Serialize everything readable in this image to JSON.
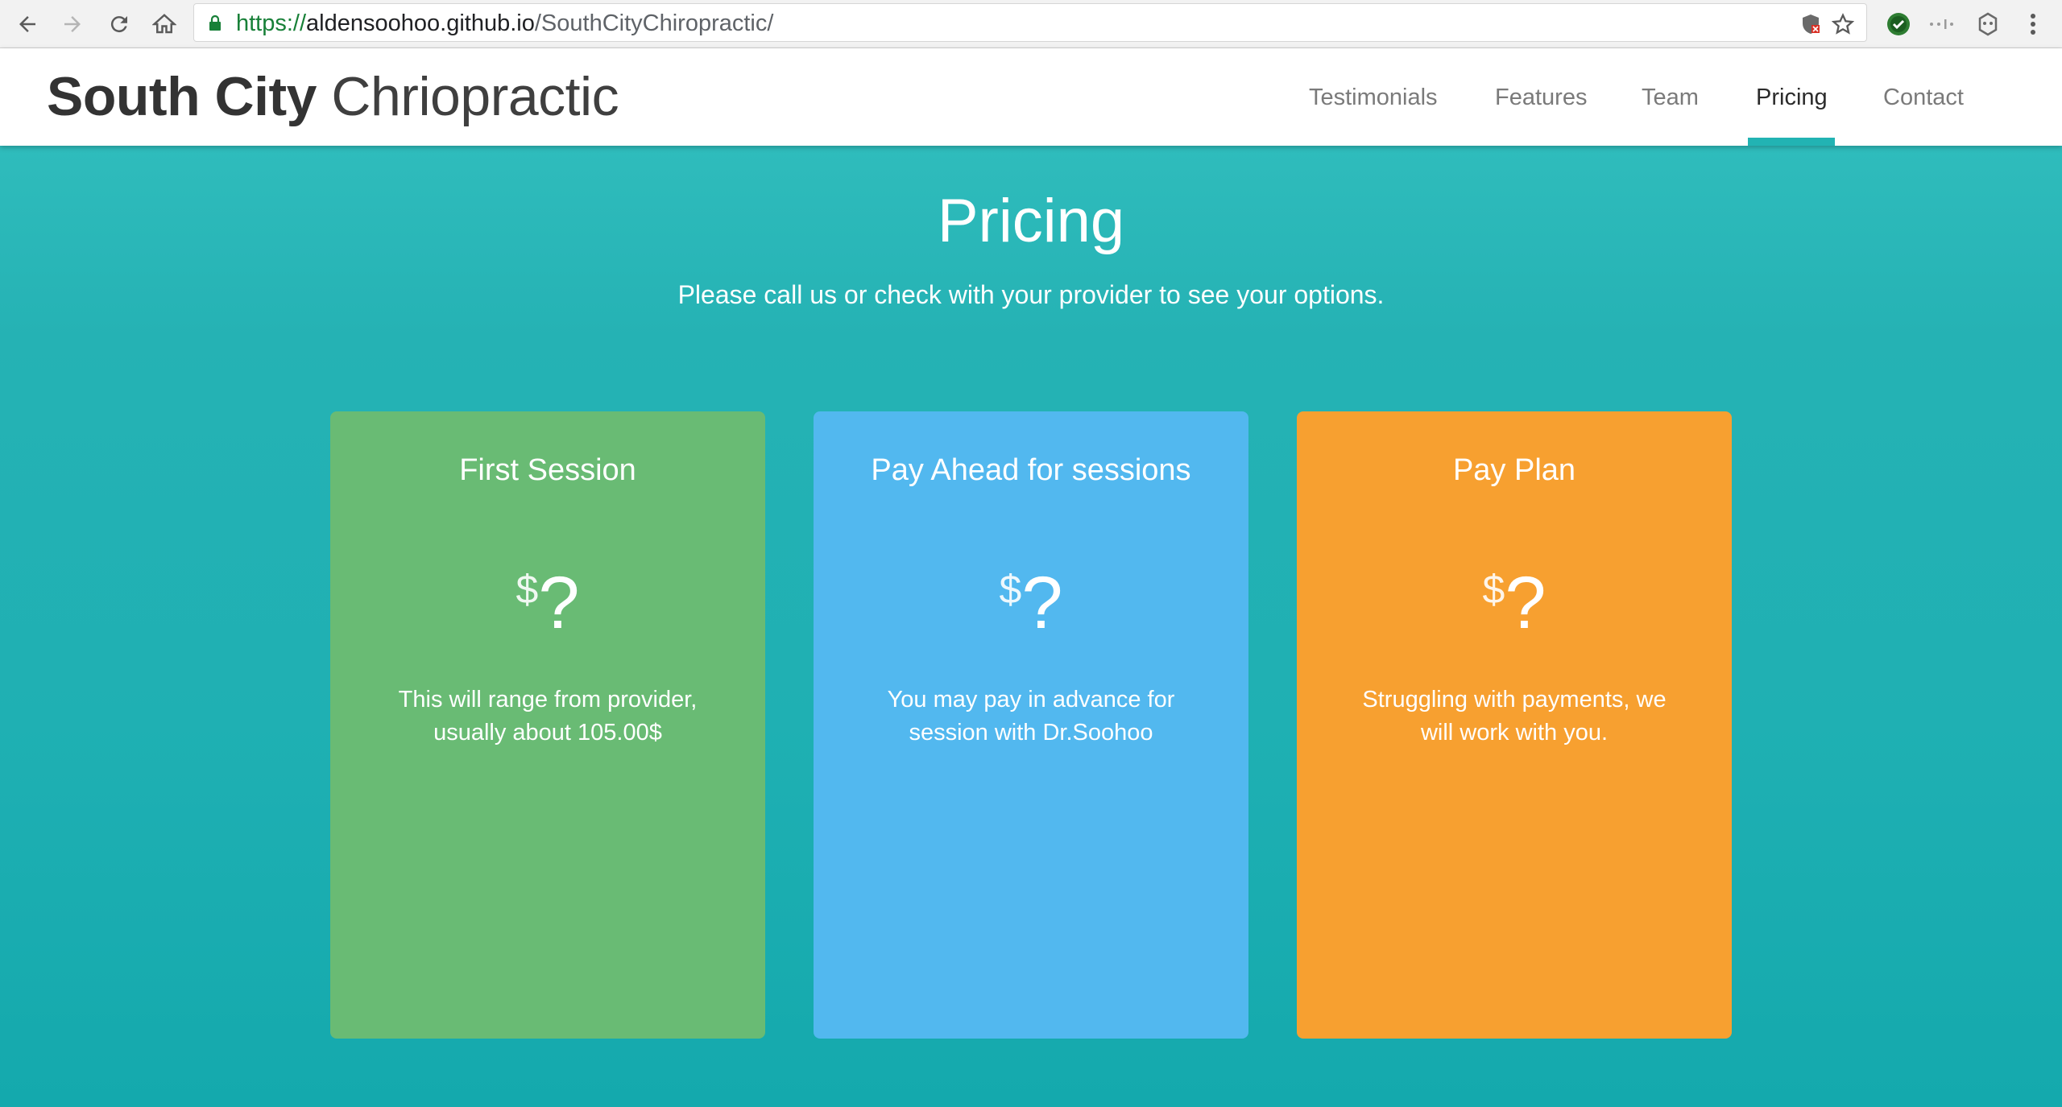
{
  "browser": {
    "url_scheme": "https://",
    "url_host": "aldensoohoo.github.io",
    "url_path": "/SouthCityChiropractic/",
    "icons": {
      "back": "back-arrow-icon",
      "forward": "forward-arrow-icon",
      "reload": "reload-icon",
      "home": "home-icon",
      "lock": "lock-icon",
      "shield": "shield-icon",
      "star": "star-icon",
      "extension_green": "extension-check-icon",
      "extension_dots": "extension-dots-icon",
      "extension_puzzle": "extension-gear-icon",
      "menu": "menu-kebab-icon"
    }
  },
  "header": {
    "brand_bold": "South City",
    "brand_light": "Chriopractic",
    "nav": [
      {
        "label": "Testimonials"
      },
      {
        "label": "Features"
      },
      {
        "label": "Team"
      },
      {
        "label": "Pricing"
      },
      {
        "label": "Contact"
      }
    ],
    "active_nav": "Pricing",
    "accent_color": "#22b3b3"
  },
  "pricing": {
    "title": "Pricing",
    "subtitle": "Please call us or check with your provider to see your options.",
    "background_color": "#22b1b4",
    "cards": [
      {
        "title": "First Session",
        "currency": "$",
        "amount": "?",
        "description": "This will range from provider, usually about 105.00$",
        "color": "#69bb74"
      },
      {
        "title": "Pay Ahead for sessions",
        "currency": "$",
        "amount": "?",
        "description": "You may pay in advance for session with Dr.Soohoo",
        "color": "#52b8ef"
      },
      {
        "title": "Pay Plan",
        "currency": "$",
        "amount": "?",
        "description": "Struggling with payments, we will work with you.",
        "color": "#f7a030"
      }
    ]
  }
}
